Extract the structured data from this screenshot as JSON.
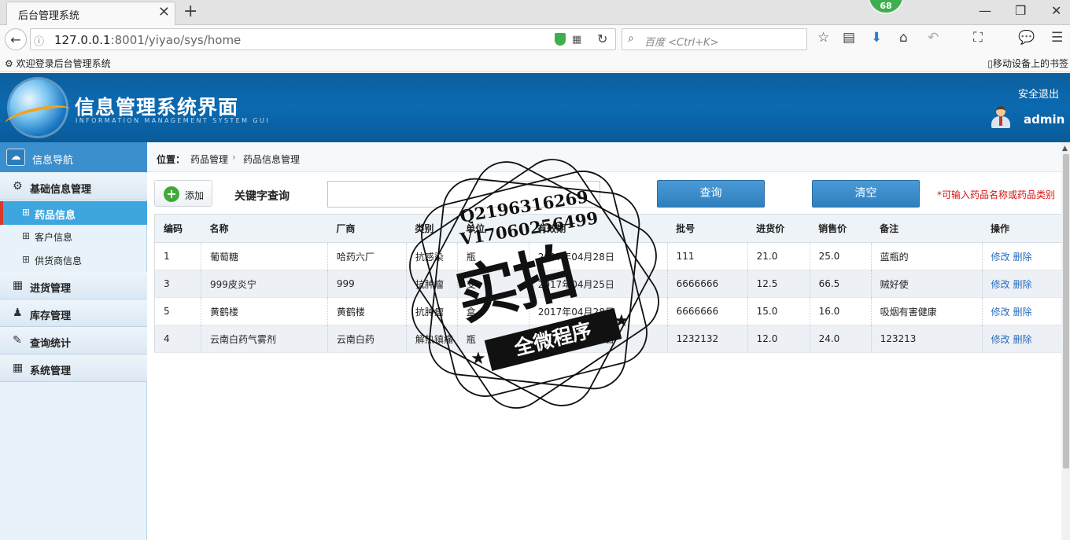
{
  "browser": {
    "tab_title": "后台管理系统",
    "tab_close": "✕",
    "new_tab": "+",
    "notification_count": "68",
    "url_host": "127.0.0.1",
    "url_rest": ":8001/yiyao/sys/home",
    "search_placeholder": "百度 <Ctrl+K>",
    "bookmark_left": "欢迎登录后台管理系统",
    "bookmark_right": "移动设备上的书签",
    "icons": [
      "back-icon",
      "info-icon",
      "shield-icon",
      "qr-icon",
      "reload-icon",
      "search-icon",
      "star-icon",
      "reader-icon",
      "download-icon",
      "home-icon",
      "undo-icon",
      "crop-icon",
      "chat-icon",
      "menu-icon"
    ]
  },
  "header": {
    "title": "信息管理系统界面",
    "subtitle": "INFORMATION MANAGEMENT SYSTEM GUI",
    "logout": "安全退出",
    "username": "admin"
  },
  "sidebar": {
    "heading": "信息导航",
    "groups": [
      {
        "label": "基础信息管理",
        "icon": "gears-icon"
      },
      {
        "label": "进货管理",
        "icon": "calendar-icon"
      },
      {
        "label": "库存管理",
        "icon": "users-icon"
      },
      {
        "label": "查询统计",
        "icon": "edit-icon"
      },
      {
        "label": "系统管理",
        "icon": "calendar-icon"
      }
    ],
    "items": [
      {
        "label": "药品信息",
        "active": true
      },
      {
        "label": "客户信息",
        "active": false
      },
      {
        "label": "供货商信息",
        "active": false
      }
    ]
  },
  "breadcrumb": {
    "position_label": "位置：",
    "level1": "药品管理",
    "separator": "›",
    "level2": "药品信息管理"
  },
  "toolbar": {
    "add_label": "添加",
    "keyword_label": "关键字查询",
    "keyword_value": "",
    "query_label": "查询",
    "clear_label": "清空",
    "hint": "*可输入药品名称或药品类别"
  },
  "table": {
    "columns": [
      "编码",
      "名称",
      "厂商",
      "类别",
      "单位",
      "有效期",
      "批号",
      "进货价",
      "销售价",
      "备注",
      "操作"
    ],
    "rows": [
      [
        "1",
        "葡萄糖",
        "哈药六厂",
        "抗感染",
        "瓶",
        "2017年04月28日",
        "111",
        "21.0",
        "25.0",
        "蓝瓶的"
      ],
      [
        "3",
        "999皮炎宁",
        "999",
        "抗肿瘤",
        "支",
        "2017年04月25日",
        "6666666",
        "12.5",
        "66.5",
        "贼好使"
      ],
      [
        "5",
        "黄鹤楼",
        "黄鹤楼",
        "抗肿瘤",
        "盒",
        "2017年04月28日",
        "6666666",
        "15.0",
        "16.0",
        "吸烟有害健康"
      ],
      [
        "4",
        "云南白药气雾剂",
        "云南白药",
        "解热镇痛",
        "瓶",
        "2017年04月28日",
        "1232132",
        "12.0",
        "24.0",
        "123213"
      ]
    ],
    "edit_label": "修改",
    "delete_label": "删除"
  },
  "watermark": {
    "line1": "Q2196316269",
    "line2": "V17060256499",
    "big": "实拍",
    "ribbon": "全微程序"
  }
}
